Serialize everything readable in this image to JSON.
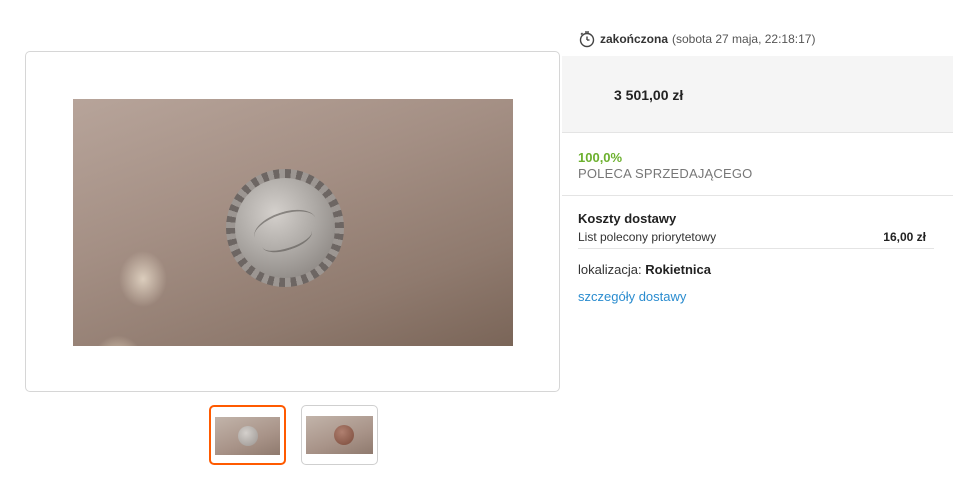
{
  "gallery": {
    "thumbnails": [
      {
        "label": "zdjęcie 1",
        "active": true,
        "cap_color": "#9a9490"
      },
      {
        "label": "zdjęcie 2",
        "active": false,
        "cap_color": "#7a4a3a"
      }
    ]
  },
  "auction": {
    "status_label": "zakończona",
    "end_time": "(sobota 27 maja, 22:18:17)",
    "price": "3 501,00 zł"
  },
  "seller": {
    "recommend_percent": "100,0%",
    "recommend_label": "POLECA SPRZEDAJĄCEGO"
  },
  "delivery": {
    "title": "Koszty dostawy",
    "method": "List polecony priorytetowy",
    "cost": "16,00 zł",
    "location_label": "lokalizacja:",
    "location_city": "Rokietnica",
    "details_link": "szczegóły dostawy"
  },
  "colors": {
    "accent_orange": "#ff5a00",
    "recommend_green": "#6cb02e",
    "link_blue": "#2a8ccf"
  }
}
